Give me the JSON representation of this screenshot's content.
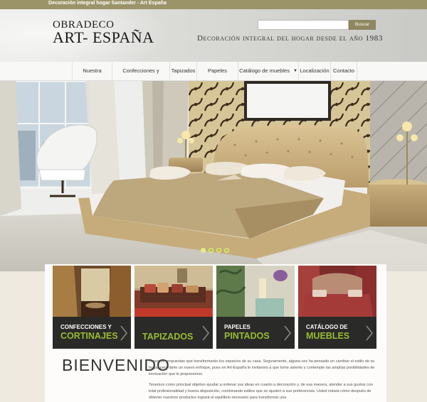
{
  "topbar": {
    "title": "Decoración integral hogar Santander - Art España"
  },
  "header": {
    "logo_line1": "OBRADECO",
    "logo_line2": "ART- ESPAÑA",
    "tagline": "Decoración integral del hogar desde el año 1983",
    "search_placeholder": "",
    "search_button": "Buscar"
  },
  "nav": {
    "items": [
      {
        "label": "Nuestra empresa"
      },
      {
        "label": "Confecciones y cortinajes"
      },
      {
        "label": "Tapizados"
      },
      {
        "label": "Papeles pintados"
      },
      {
        "label": "Catálogo de muebles"
      },
      {
        "label": "Localización"
      },
      {
        "label": "Contacto"
      }
    ]
  },
  "slider": {
    "slides": 4,
    "active": 1
  },
  "cards": [
    {
      "line1": "CONFECCIONES Y",
      "line2": "CORTINAJES"
    },
    {
      "line1": "",
      "line2": "TAPIZADOS"
    },
    {
      "line1": "PAPELES",
      "line2": "PINTADOS"
    },
    {
      "line1": "CATÁLOGO DE",
      "line2": "MUEBLES"
    }
  ],
  "welcome": {
    "title": "BIENVENIDO",
    "paragraph1": "Tenemos propuestas que transformarán los espacios de su casa. Seguramente, alguna vez ha pensado en cambiar el estilo de su hogar para darle un nuevo enfoque, pues en Art-España le invitamos a que tome asiento y contemple las amplias posibilidades de innovación que le proponemos.",
    "paragraph2": "Tenemos como principal objetivo ayudar a ordenar sus ideas en cuanto a decoración y, de esa manera, atender a sus gustos con total profesionalidad y buena disposición, combinando estilos que se ajusten a sus preferencias. Usted notará cómo después de obtener nuestros productos logrará el equilibrio necesario para transformar una"
  },
  "colors": {
    "accent": "#9abb33",
    "topbar": "#9c9469",
    "button": "#8e8760"
  }
}
